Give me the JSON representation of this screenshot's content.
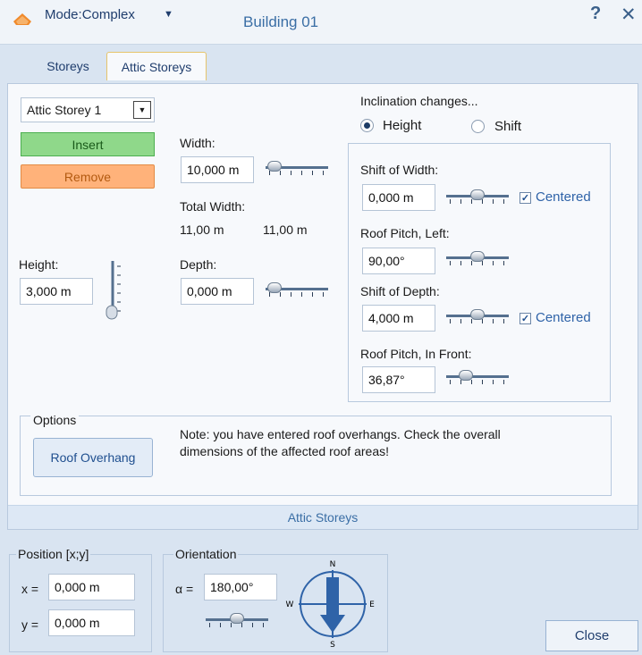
{
  "header": {
    "mode_label": "Mode:Complex",
    "title": "Building 01",
    "help_glyph": "?",
    "close_glyph": "✕"
  },
  "tabs": [
    {
      "label": "Storeys",
      "active": false
    },
    {
      "label": "Attic Storeys",
      "active": true
    }
  ],
  "attic": {
    "selected_storey": "Attic Storey 1",
    "insert_label": "Insert",
    "remove_label": "Remove",
    "height_label": "Height:",
    "height_value": "3,000 m",
    "width_label": "Width:",
    "width_value": "10,000 m",
    "total_width_label": "Total Width:",
    "total_width_a": "11,00 m",
    "total_width_b": "11,00 m",
    "depth_label": "Depth:",
    "depth_value": "0,000 m",
    "footer_label": "Attic Storeys"
  },
  "inclination": {
    "title": "Inclination changes...",
    "option_height": "Height",
    "option_shift": "Shift",
    "selected": "Height",
    "shift_width_label": "Shift of Width:",
    "shift_width_value": "0,000 m",
    "centered_label_1": "Centered",
    "centered_1_checked": true,
    "roof_pitch_left_label": "Roof Pitch, Left:",
    "roof_pitch_left_value": "90,00°",
    "shift_depth_label": "Shift of Depth:",
    "shift_depth_value": "4,000 m",
    "centered_label_2": "Centered",
    "centered_2_checked": true,
    "roof_pitch_front_label": "Roof Pitch, In Front:",
    "roof_pitch_front_value": "36,87°"
  },
  "options": {
    "group_label": "Options",
    "overhang_button": "Roof Overhang",
    "note": "Note: you have entered roof overhangs. Check the overall dimensions of the affected roof areas!"
  },
  "position": {
    "group_label": "Position [x;y]",
    "x_label": "x =",
    "x_value": "0,000 m",
    "y_label": "y =",
    "y_value": "0,000 m"
  },
  "orientation": {
    "group_label": "Orientation",
    "alpha_label": "α =",
    "alpha_value": "180,00°",
    "compass": {
      "n": "N",
      "s": "S",
      "e": "E",
      "w": "W"
    }
  },
  "close_label": "Close",
  "colors": {
    "accent": "#3a6ea5",
    "insert": "#8fd88a",
    "remove": "#ffb27a",
    "compass": "#2f63a8"
  }
}
